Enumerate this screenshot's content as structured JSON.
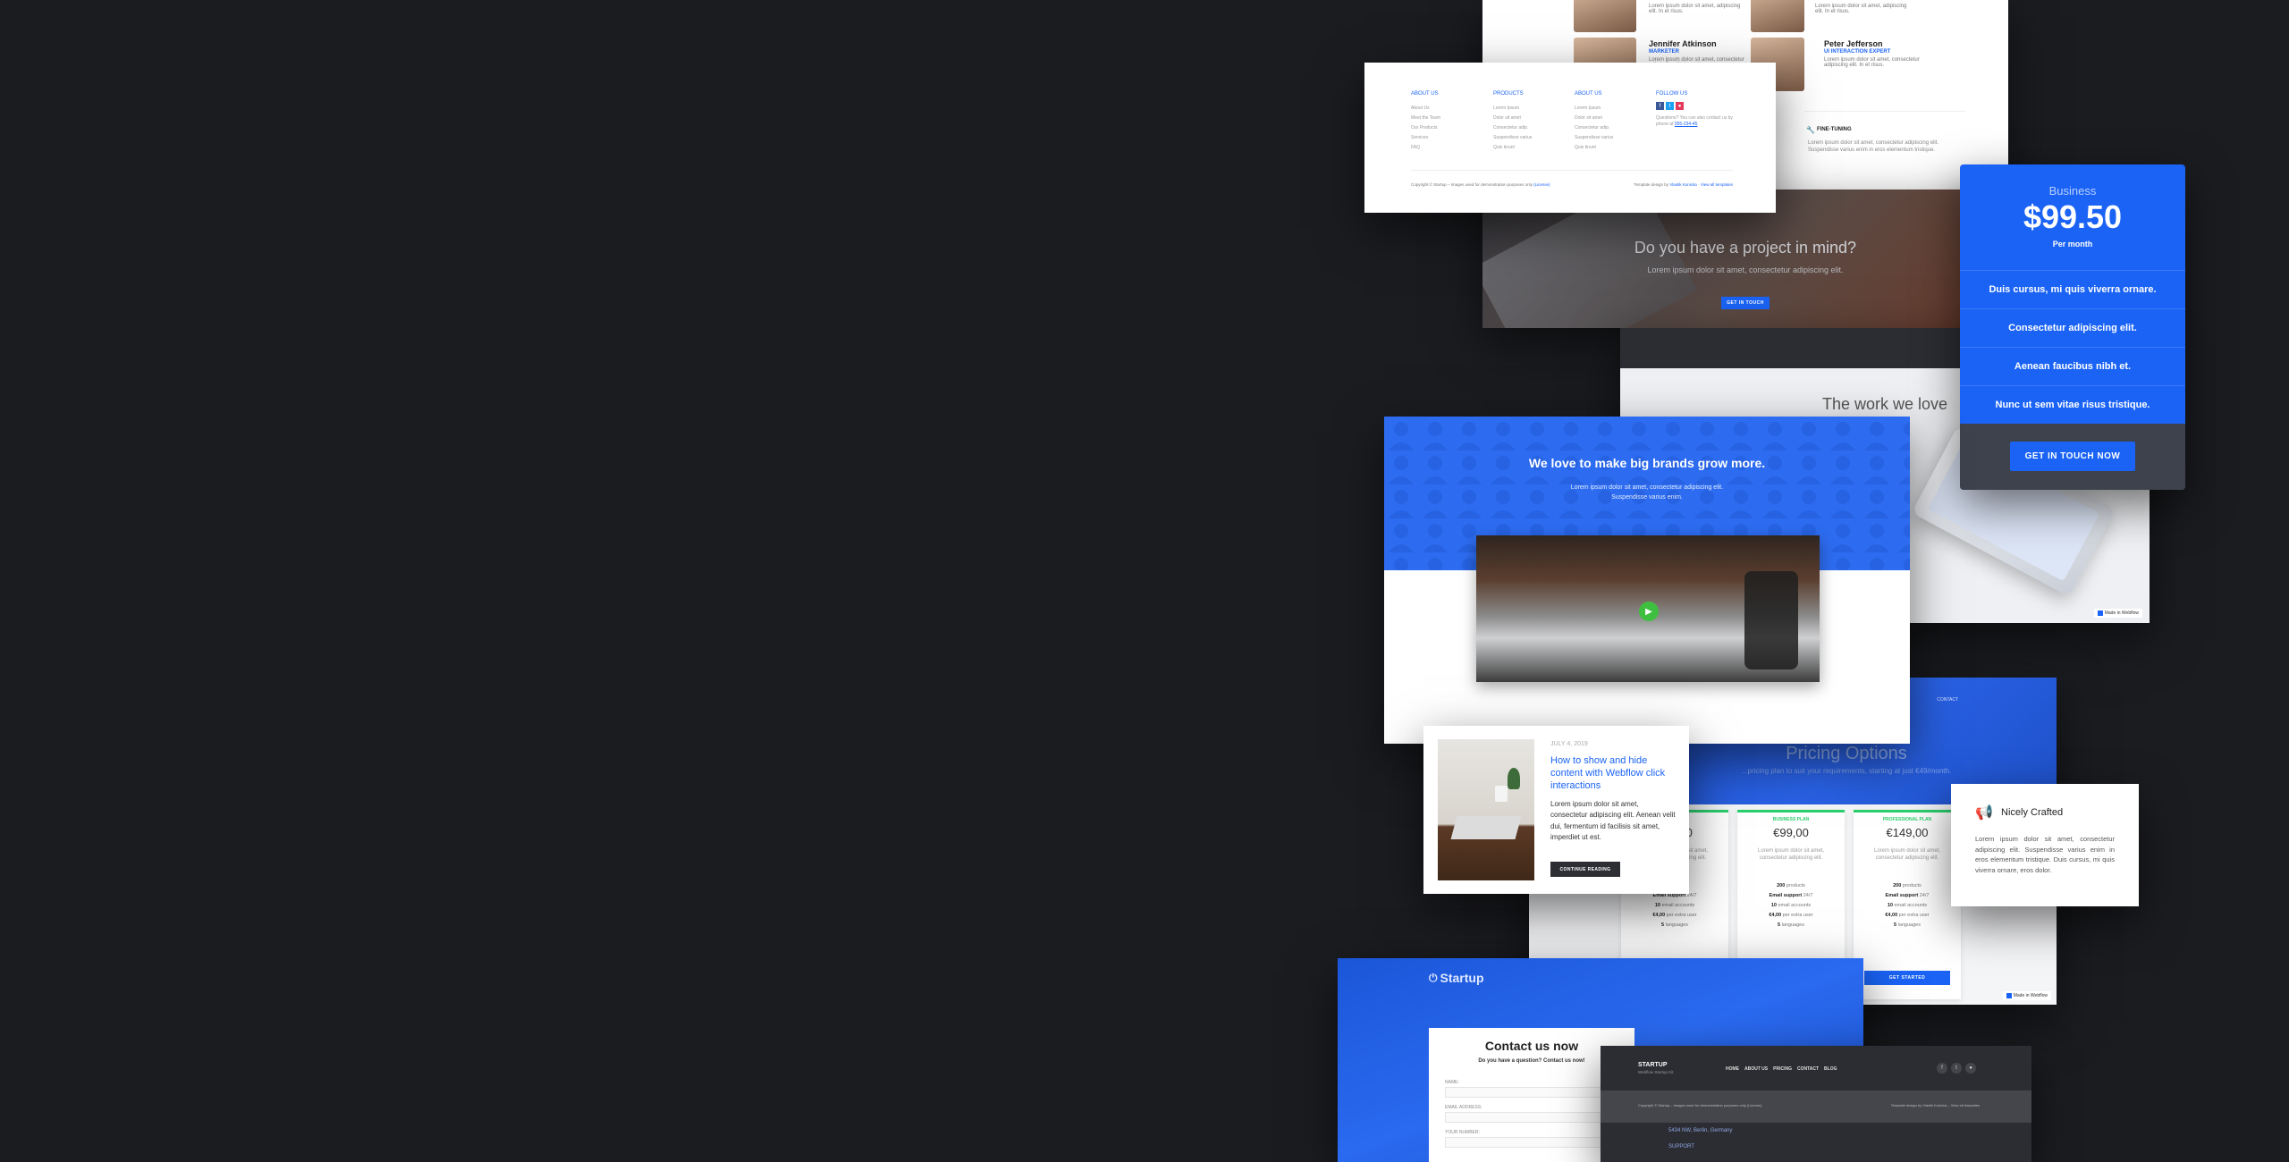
{
  "team": {
    "people": [
      {
        "name": "",
        "role": "",
        "text": "Lorem ipsum dolor sit amet, adipiscing elit. In et risus."
      },
      {
        "name": "",
        "role": "",
        "text": "Lorem ipsum dolor sit amet, adipiscing elit. In et risus."
      },
      {
        "name": "Jennifer Atkinson",
        "role": "MARKETER",
        "text": "Lorem ipsum dolor sit amet, consectetur adipiscing elit. In et risus."
      },
      {
        "name": "Peter Jefferson",
        "role": "UI INTERACTION EXPERT",
        "text": "Lorem ipsum dolor sit amet, consectetur adipiscing elit. In et risus."
      }
    ],
    "fine_tuning_label": "FINE-TUNING",
    "fine_tuning_text": "Lorem ipsum dolor sit amet, consectetur adipiscing elit. Suspendisse varius enim in eros elementum tristique."
  },
  "footer_card": {
    "columns": [
      {
        "title": "ABOUT US",
        "items": [
          "About Us",
          "Meet the Team",
          "Our Products",
          "Services",
          "FAQ"
        ]
      },
      {
        "title": "PRODUCTS",
        "items": [
          "Lorem Ipsum",
          "Dolor sit amet",
          "Consectetur adip.",
          "Suspendisse varius",
          "Quis tinunt"
        ]
      },
      {
        "title": "ABOUT US",
        "items": [
          "Lorem Ipsum",
          "Dolor sit amet",
          "Consectetur adip.",
          "Suspendisse varius",
          "Quis tinunt"
        ]
      },
      {
        "title": "FOLLOW US",
        "items": []
      }
    ],
    "follow_text": "Questions? You can also contact us by phone at",
    "follow_phone": "555-234-45",
    "copyright": "Copyright © Startup – Images used for demonstration purposes only",
    "copyright_link": "(License)",
    "credits": "Template design by",
    "credits_link1": "Vlastik Konicka",
    "credits_link2": "View all templates"
  },
  "project_cta": {
    "heading": "Do you have a project in mind?",
    "text": "Lorem ipsum dolor sit amet, consectetur adipiscing elit.",
    "button": "GET IN TOUCH"
  },
  "work": {
    "heading": "The work we love",
    "badge": "Made in Webflow"
  },
  "pricing_card": {
    "tier": "Business",
    "price": "$99.50",
    "period": "Per month",
    "features": [
      "Duis cursus, mi quis viverra ornare.",
      "Consectetur adipiscing elit.",
      "Aenean faucibus nibh et.",
      "Nunc ut sem vitae risus tristique."
    ],
    "button": "GET IN TOUCH NOW"
  },
  "brands": {
    "heading": "We love to make big brands grow more.",
    "text_line1": "Lorem ipsum dolor sit amet, consectetur adipiscing elit.",
    "text_line2": "Suspendisse varius enim."
  },
  "pricing_options": {
    "nav_contact": "CONTACT",
    "heading": "Pricing Options",
    "subtitle": "...pricing plan to suit your requirements, starting at just €49/month.",
    "plans": [
      {
        "name": "",
        "price": "€49,00"
      },
      {
        "name": "BUSINESS PLAN",
        "price": "€99,00"
      },
      {
        "name": "PROFESSIONAL PLAN",
        "price": "€149,00"
      }
    ],
    "plan_text": "Lorem ipsum dolor sit amet, consectetur adipiscing elit.",
    "plan_rows": [
      [
        "200",
        "products"
      ],
      [
        "Email support",
        "24/7"
      ],
      [
        "10",
        "email accounts"
      ],
      [
        "€4,00",
        "per extra user"
      ],
      [
        "5",
        "languages"
      ]
    ],
    "button": "GET STARTED",
    "badge": "Made in Webflow"
  },
  "blog": {
    "date": "JULY 4, 2019",
    "title": "How to show and hide content with Webflow click interactions",
    "text": "Lorem ipsum dolor sit amet, consectetur adipiscing elit. Aenean velit dui, fermentum id facilisis sit amet, imperdiet ut est.",
    "button": "CONTINUE READING"
  },
  "crafted": {
    "title": "Nicely Crafted",
    "text": "Lorem ipsum dolor sit amet, consectetur adipiscing elit. Suspendisse varius enim in eros elementum tristique. Duis cursus, mi quis viverra ornare, eros dolor."
  },
  "contact": {
    "logo": "Startup",
    "heading": "Contact us now",
    "subtitle": "Do you have a question? Contact us now!",
    "field_name": "NAME:",
    "field_email": "EMAIL ADDRESS:",
    "field_phone": "YOUR NUMBER:"
  },
  "dark_footer": {
    "brand": "STARTUP",
    "tagline": "Webflow Startup Kit",
    "nav": [
      "HOME",
      "ABOUT US",
      "PRICING",
      "CONTACT",
      "BLOG"
    ],
    "copyright": "Copyright © Startup – Images used for demonstration purposes only (License).",
    "credits": "Template design by Vlastik Konicka – View all templates",
    "address": "5434 NW, Berlin, Germany",
    "support": "SUPPORT"
  }
}
